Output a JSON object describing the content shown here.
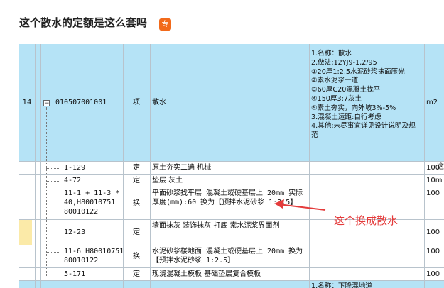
{
  "post": {
    "title": "这个散水的定额是这么套吗",
    "badge": "专"
  },
  "table": {
    "rows": [
      {
        "index": "14",
        "code": "010507001001",
        "type": "项",
        "name": "散水",
        "description": "1.名称：散水\n2.做法:12YJ9-1,2/95\n①20厚1:2.5水泥砂浆抹面压光\n②素水泥浆一道\n③60厚C20混凝土找平\n④150厚3:7灰土\n⑤素土夯实，向外坡3%-5%\n3.混凝土运距:自行考虑\n4.其他:未尽事宜详见设计说明及规范",
        "unit": "m2"
      },
      {
        "index": "",
        "code": "1-129",
        "type": "定",
        "name": "原土夯实二遍 机械",
        "description": "",
        "unit": "100"
      },
      {
        "index": "",
        "code": "4-72",
        "type": "定",
        "name": "垫层 灰土",
        "description": "",
        "unit": "10m"
      },
      {
        "index": "",
        "code": "11-1 + 11-3 * 40,H80010751 80010122",
        "type": "换",
        "name": "平面砂浆找平层 混凝土或硬基层上 20mm 实际厚度(mm):60 换为【预拌水泥砂浆 1:2.5】",
        "description": "",
        "unit": "100"
      },
      {
        "index": "",
        "code": "12-23",
        "type": "定",
        "name": "墙面抹灰 装饰抹灰 打底 素水泥浆界面剂",
        "description": "",
        "unit": "100"
      },
      {
        "index": "",
        "code": "11-6 H80010751 80010122",
        "type": "换",
        "name": "水泥砂浆楼地面 混凝土或硬基层上 20mm 换为【预拌水泥砂浆 1:2.5】",
        "description": "",
        "unit": "100"
      },
      {
        "index": "",
        "code": "5-171",
        "type": "定",
        "name": "现浇混凝土模板 基础垫层复合模板",
        "description": "",
        "unit": "100"
      },
      {
        "index": "",
        "code": "",
        "type": "",
        "name": "",
        "description": "1.名称：下降混地道",
        "unit": ""
      }
    ]
  },
  "annotation": {
    "text": "这个换成散水",
    "color": "#e43b3b"
  },
  "right_fragment": "这"
}
